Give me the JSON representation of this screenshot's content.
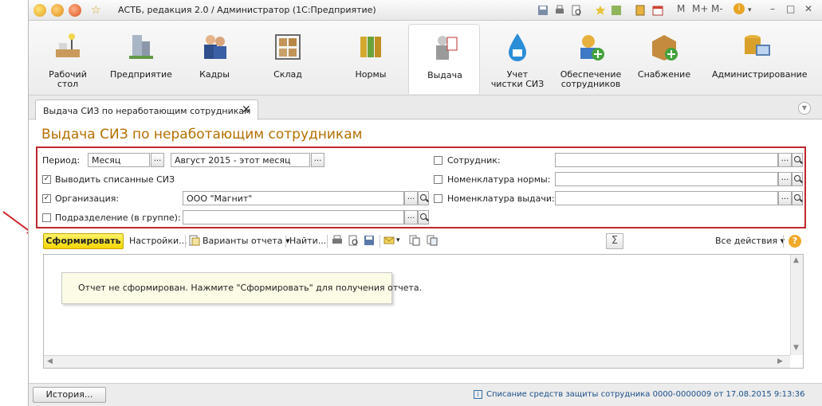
{
  "window": {
    "title": "АСТБ, редакция 2.0 / Администратор  (1С:Предприятие)",
    "right_controls": [
      "M",
      "M+",
      "M-"
    ]
  },
  "sections": [
    {
      "label": "Рабочий\nстол",
      "icon": "desk-icon"
    },
    {
      "label": "Предприятие",
      "icon": "enterprise-icon"
    },
    {
      "label": "Кадры",
      "icon": "staff-icon"
    },
    {
      "label": "Склад",
      "icon": "warehouse-icon"
    },
    {
      "label": "Нормы",
      "icon": "norms-icon"
    },
    {
      "label": "Выдача",
      "icon": "issue-icon"
    },
    {
      "label": "Учет\nчистки СИЗ",
      "icon": "cleaning-icon"
    },
    {
      "label": "Обеспечение\nсотрудников",
      "icon": "supply-staff-icon"
    },
    {
      "label": "Снабжение",
      "icon": "procurement-icon"
    },
    {
      "label": "Администрирование",
      "icon": "admin-icon"
    }
  ],
  "tab": {
    "label": "Выдача СИЗ по неработающим сотрудникам",
    "close": "✕"
  },
  "form": {
    "title": "Выдача СИЗ по неработающим сотрудникам",
    "period_label": "Период:",
    "period_type": "Месяц",
    "period_value": "Август 2015 - этот месяц",
    "show_written_off_label": "Выводить списанные СИЗ",
    "show_written_off_checked": true,
    "org_label": "Организация:",
    "org_checked": true,
    "org_value": "ООО \"Магнит\"",
    "dept_label": "Подразделение (в группе):",
    "dept_checked": false,
    "dept_value": "",
    "employee_label": "Сотрудник:",
    "employee_checked": false,
    "norm_item_label": "Номенклатура нормы:",
    "norm_item_checked": false,
    "issue_item_label": "Номенклатура выдачи:",
    "issue_item_checked": false,
    "dots": "..."
  },
  "commands": {
    "generate": "Сформировать",
    "settings": "Настройки...",
    "variants": "Варианты отчета",
    "find": "Найти...",
    "all_actions": "Все действия",
    "sum": "Σ",
    "help": "?"
  },
  "report": {
    "message": "Отчет не сформирован. Нажмите \"Сформировать\" для получения отчета."
  },
  "footer": {
    "history": "История...",
    "status": "Списание средств защиты сотрудника 0000-0000009 от 17.08.2015 9:13:36",
    "status_icon": "i"
  },
  "colors": {
    "accent_title": "#b56f00",
    "highlight_border": "#c0272d",
    "generate_button": "#f2d600",
    "status_link": "#1a4f8a"
  }
}
